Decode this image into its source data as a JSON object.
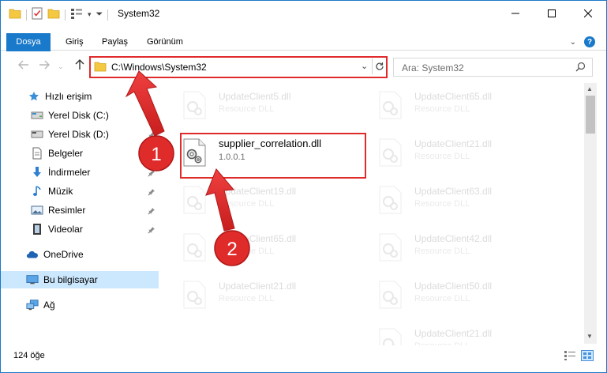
{
  "window": {
    "title": "System32"
  },
  "ribbon": {
    "tabs": [
      {
        "label": "Dosya",
        "active": true
      },
      {
        "label": "Giriş",
        "active": false
      },
      {
        "label": "Paylaş",
        "active": false
      },
      {
        "label": "Görünüm",
        "active": false
      }
    ],
    "help_label": "?"
  },
  "address": {
    "path": "C:\\Windows\\System32",
    "search_placeholder": "Ara: System32"
  },
  "sidebar": {
    "items": [
      {
        "label": "Hızlı erişim",
        "icon": "star-icon",
        "pinned": false
      },
      {
        "label": "Yerel Disk (C:)",
        "icon": "drive-icon",
        "pinned": true
      },
      {
        "label": "Yerel Disk (D:)",
        "icon": "drive-icon",
        "pinned": true
      },
      {
        "label": "Belgeler",
        "icon": "document-icon",
        "pinned": true
      },
      {
        "label": "İndirmeler",
        "icon": "download-icon",
        "pinned": true
      },
      {
        "label": "Müzik",
        "icon": "music-icon",
        "pinned": true
      },
      {
        "label": "Resimler",
        "icon": "pictures-icon",
        "pinned": true
      },
      {
        "label": "Videolar",
        "icon": "video-icon",
        "pinned": true
      },
      {
        "label": "OneDrive",
        "icon": "cloud-icon",
        "pinned": false
      },
      {
        "label": "Bu bilgisayar",
        "icon": "computer-icon",
        "pinned": false,
        "selected": true
      },
      {
        "label": "Ağ",
        "icon": "network-icon",
        "pinned": false
      }
    ]
  },
  "files": {
    "highlighted": {
      "name": "supplier_correlation.dll",
      "version": "1.0.0.1"
    },
    "background_left": [
      {
        "name": "UpdateClient5.dll",
        "desc": "Resource DLL"
      },
      {
        "name": "UpdateClient19.dll",
        "desc": "Resource DLL"
      },
      {
        "name": "UpdateClient65.dll",
        "desc": "Resource DLL"
      },
      {
        "name": "UpdateClient21.dll",
        "desc": "Resource DLL"
      }
    ],
    "background_right": [
      {
        "name": "UpdateClient65.dll",
        "desc": "Resource DLL"
      },
      {
        "name": "UpdateClient21.dll",
        "desc": "Resource DLL"
      },
      {
        "name": "UpdateClient63.dll",
        "desc": "Resource DLL"
      },
      {
        "name": "UpdateClient42.dll",
        "desc": "Resource DLL"
      },
      {
        "name": "UpdateClient50.dll",
        "desc": "Resource DLL"
      },
      {
        "name": "UpdateClient21.dll",
        "desc": "Resource DLL"
      }
    ]
  },
  "status": {
    "item_count": "124 öğe"
  },
  "annotations": {
    "step1": "1",
    "step2": "2",
    "color": "#e02b2b"
  },
  "colors": {
    "accent": "#1979ca",
    "selected_bg": "#cce8ff",
    "highlight": "#e02b2b"
  }
}
